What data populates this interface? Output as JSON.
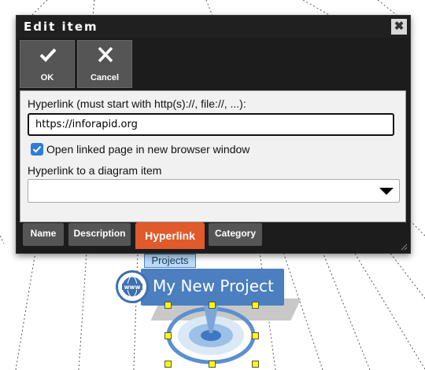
{
  "dialog": {
    "title": "Edit item",
    "close_icon": "close-icon",
    "toolbar": {
      "ok_label": "OK",
      "cancel_label": "Cancel"
    },
    "hyperlink_label": "Hyperlink (must start with http(s)://, file://, ...):",
    "hyperlink_value": "https://inforapid.org",
    "open_new_window_label": "Open linked page in new browser window",
    "open_new_window_checked": true,
    "diagram_link_label": "Hyperlink to a diagram item",
    "diagram_link_value": "",
    "tabs": [
      {
        "label": "Name",
        "active": false
      },
      {
        "label": "Description",
        "active": false
      },
      {
        "label": "Hyperlink",
        "active": true
      },
      {
        "label": "Category",
        "active": false
      }
    ],
    "colors": {
      "dialog_bg": "#1c1c1c",
      "button_bg": "#555555",
      "active_tab": "#e05a2b",
      "checkbox": "#2e7ed6"
    }
  },
  "diagram": {
    "category_tag": "Projects",
    "node_label": "My New Project",
    "node_icon": "www-globe-icon",
    "colors": {
      "node_bg": "#4b7fbf",
      "handle": "#ffff00"
    }
  }
}
